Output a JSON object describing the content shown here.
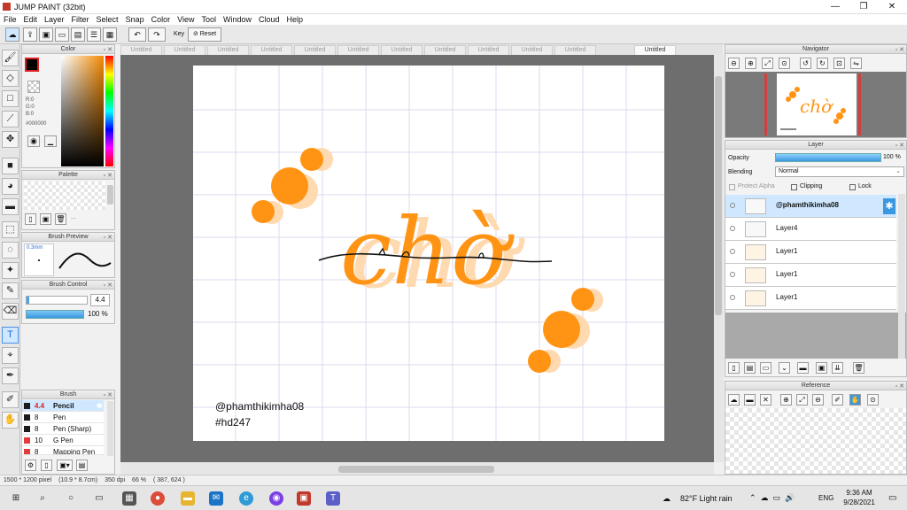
{
  "window": {
    "title": "JUMP PAINT (32bit)"
  },
  "menu": [
    "File",
    "Edit",
    "Layer",
    "Filter",
    "Select",
    "Snap",
    "Color",
    "View",
    "Tool",
    "Window",
    "Cloud",
    "Help"
  ],
  "toolbar": {
    "key_label": "Key",
    "reset_label": "Reset"
  },
  "tabs": [
    "Untitled",
    "Untitled",
    "Untitled",
    "Untitled",
    "Untitled",
    "Untitled",
    "Untitled",
    "Untitled",
    "Untitled",
    "Untitled",
    "Untitled",
    "Untitled"
  ],
  "color_panel": {
    "title": "Color",
    "r": "R:0",
    "g": "G:0",
    "b": "B:0",
    "hex": "#000000",
    "current_color": "#000000"
  },
  "palette_panel": {
    "title": "Palette",
    "ellipsis": "..."
  },
  "brush_preview": {
    "title": "Brush Preview",
    "size_label": "0.3mm"
  },
  "brush_control": {
    "title": "Brush Control",
    "size_value": "4.4",
    "opacity_value": "100 %"
  },
  "brush_panel": {
    "title": "Brush",
    "items": [
      {
        "size": "4.4",
        "name": "Pencil",
        "color": "#111111"
      },
      {
        "size": "8",
        "name": "Pen",
        "color": "#111111"
      },
      {
        "size": "8",
        "name": "Pen (Sharp)",
        "color": "#111111"
      },
      {
        "size": "10",
        "name": "G Pen",
        "color": "#e23b3b"
      },
      {
        "size": "8",
        "name": "Mapping Pen",
        "color": "#e23b3b"
      }
    ]
  },
  "canvas": {
    "watermark_user": "@phamthikimha08",
    "watermark_tag": "#hd247",
    "accent_color": "#ff9414"
  },
  "navigator": {
    "title": "Navigator"
  },
  "layer_panel": {
    "title": "Layer",
    "opacity_label": "Opacity",
    "opacity_value": "100 %",
    "blending_label": "Blending",
    "blending_value": "Normal",
    "protect_alpha": "Protect Alpha",
    "clipping": "Clipping",
    "lock": "Lock",
    "layers": [
      "@phamthikimha08",
      "Layer4",
      "Layer1",
      "Layer1",
      "Layer1"
    ]
  },
  "reference": {
    "title": "Reference"
  },
  "status": {
    "size": "1500 * 1200 pixel",
    "physical": "(10.9 * 8.7cm)",
    "dpi": "350 dpi",
    "zoom": "66 %",
    "coords": "( 387, 624 )"
  },
  "taskbar": {
    "weather": "82°F  Light rain",
    "lang": "ENG",
    "time": "9:36 AM",
    "date": "9/28/2021"
  }
}
